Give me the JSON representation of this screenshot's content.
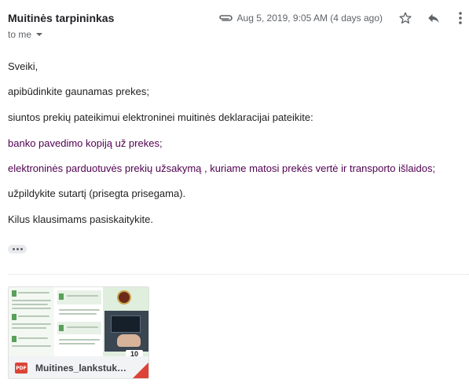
{
  "header": {
    "sender": "Muitinės tarpininkas",
    "recipient_label": "to me",
    "date": "Aug 5, 2019, 9:05 AM (4 days ago)"
  },
  "icons": {
    "attachment": "paperclip-icon",
    "star": "star-icon",
    "reply": "reply-icon",
    "more": "more-vert-icon"
  },
  "body": {
    "lines": [
      " Sveiki,",
      "apibūdinkite gaunamas prekes;",
      "siuntos prekių pateikimui elektroninei muitinės deklaracijai  pateikite:",
      "banko pavedimo kopiją už prekes;",
      "elektroninės parduotuvės prekių  užsakymą , kuriame matosi prekės vertė ir transporto išlaidos;",
      "užpildykite sutartį (prisegta prisegama).",
      "Kilus klausimams pasiskaitykite."
    ]
  },
  "attachment": {
    "type_label": "PDF",
    "filename": "Muitines_lankstukas.pdf",
    "thumb_page_number": "10"
  },
  "colors": {
    "link_text": "#500050",
    "pdf_red": "#db4437",
    "meta_gray": "#5f6368"
  }
}
